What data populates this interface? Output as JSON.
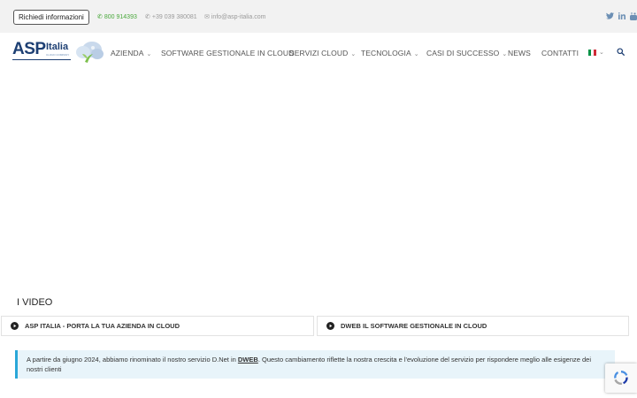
{
  "topbar": {
    "request_button": "Richiedi informazioni",
    "phone_free": "800 914393",
    "phone": "+39 039 380081",
    "email": "info@asp-italia.com",
    "social_icons": [
      "twitter-icon",
      "linkedin-icon",
      "youtube-icon"
    ]
  },
  "logo": {
    "brand": "ASP",
    "name": "Italia",
    "tagline": "CLOUD COMPANY"
  },
  "nav": {
    "items": [
      {
        "label": "AZIENDA",
        "dropdown": true
      },
      {
        "label": "SOFTWARE GESTIONALE IN CLOUD",
        "dropdown": false
      },
      {
        "label": "SERVIZI CLOUD",
        "dropdown": true
      },
      {
        "label": "TECNOLOGIA",
        "dropdown": true
      },
      {
        "label": "CASI DI SUCCESSO",
        "dropdown": true
      },
      {
        "label": "NEWS",
        "dropdown": false
      },
      {
        "label": "CONTATTI",
        "dropdown": false
      }
    ],
    "language_flag": "italian-flag-icon"
  },
  "section": {
    "title": "I VIDEO",
    "tabs": [
      {
        "label": "ASP ITALIA - PORTA LA TUA AZIENDA IN CLOUD"
      },
      {
        "label": "DWEB IL SOFTWARE GESTIONALE IN CLOUD"
      }
    ]
  },
  "notice": {
    "before": "A partire da giugno 2024, abbiamo rinominato il nostro servizio D.Net in ",
    "link": "DWEB",
    "after": ". Questo cambiamento riflette la nostra crescita e l'evoluzione del servizio per rispondere meglio alle esigenze dei nostri clienti"
  },
  "colors": {
    "brand_blue": "#1d3f73",
    "accent_green": "#49a83b",
    "info_border": "#2aa7d8",
    "info_background": "#e8f4fa"
  }
}
